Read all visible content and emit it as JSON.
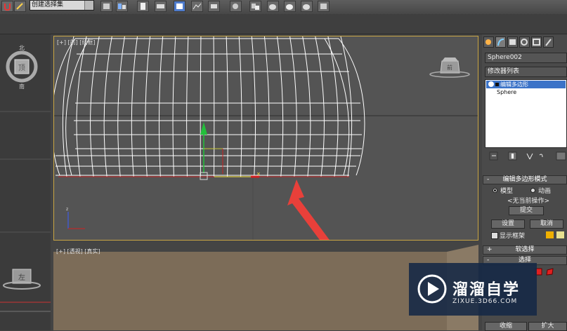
{
  "toolbar": {
    "selection_set_value": "创建选择集",
    "button_icons": [
      "select-filter-icon",
      "align-icon",
      "layer-icon",
      "curve-editor-icon",
      "schematic-icon",
      "material-icon",
      "render-setup-icon",
      "render-frame-icon",
      "render-icon",
      "environment-icon",
      "teapot-render-icon",
      "teapot-active-icon",
      "image-icon"
    ]
  },
  "viewport_front": {
    "label": "[+] [前] [线框]",
    "viewcube_label": "前"
  },
  "viewport_persp": {
    "label": "[+] [透视] [真实]",
    "viewcube_label": "左"
  },
  "command_panel": {
    "tab_icons": [
      "create-icon",
      "modify-icon",
      "hierarchy-icon",
      "motion-icon",
      "display-icon",
      "utilities-icon"
    ],
    "object_name": "Sphere002",
    "modifier_list": "修改器列表",
    "stack": {
      "selected": "编辑多边形",
      "base": "Sphere"
    },
    "stack_tool_icons": [
      "pin-stack-icon",
      "show-end-result-icon",
      "make-unique-icon",
      "remove-modifier-icon",
      "configure-sets-icon"
    ],
    "rollout_edit_poly": {
      "title": "编辑多边形模式",
      "mode_model": "模型",
      "mode_animate": "动画",
      "current_op": "<无当前操作>",
      "commit": "提交",
      "settings": "设置",
      "cancel": "取消",
      "show_cage": "显示框架"
    },
    "rollout_soft_select": {
      "title": "软选择"
    },
    "rollout_select": {
      "title": "选择"
    },
    "collapse": "收缩",
    "expand": "扩大"
  },
  "watermark": {
    "title": "溜溜自学",
    "url": "ZIXUE.3D66.COM"
  },
  "colors": {
    "viewport_active_border": "#c8a544",
    "stack_highlight": "#3b73c8",
    "annotation_arrow": "#e8403a",
    "axis_green": "#22c03a",
    "axis_red": "#d22020"
  }
}
